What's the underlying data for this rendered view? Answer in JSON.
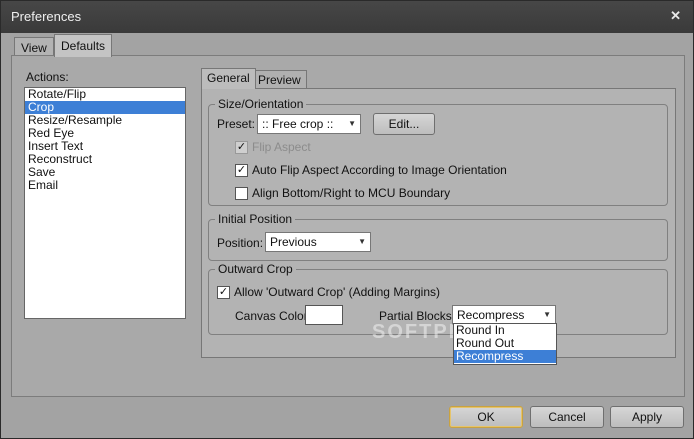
{
  "window": {
    "title": "Preferences",
    "close_glyph": "✕"
  },
  "outer_tabs": [
    {
      "label": "View"
    },
    {
      "label": "Defaults"
    }
  ],
  "actions": {
    "label": "Actions:",
    "items": [
      "Rotate/Flip",
      "Crop",
      "Resize/Resample",
      "Red Eye",
      "Insert Text",
      "Reconstruct",
      "Save",
      "Email"
    ],
    "selected": "Crop"
  },
  "inner_tabs": [
    {
      "label": "General"
    },
    {
      "label": "Preview"
    }
  ],
  "size_orientation": {
    "title": "Size/Orientation",
    "preset_label": "Preset:",
    "preset_value": ":: Free crop ::",
    "edit_button": "Edit...",
    "flip_aspect": {
      "label": "Flip Aspect",
      "checked": true,
      "enabled": false
    },
    "auto_flip": {
      "label": "Auto Flip Aspect According to Image Orientation",
      "checked": true
    },
    "align_mcu": {
      "label": "Align Bottom/Right to MCU Boundary",
      "checked": false
    }
  },
  "initial_position": {
    "title": "Initial Position",
    "position_label": "Position:",
    "position_value": "Previous"
  },
  "outward_crop": {
    "title": "Outward Crop",
    "allow": {
      "label": "Allow 'Outward Crop' (Adding Margins)",
      "checked": true
    },
    "canvas_color_label": "Canvas Color:",
    "canvas_color": "#ffffff",
    "partial_blocks_label": "Partial Blocks:",
    "partial_blocks_value": "Recompress",
    "partial_blocks_options": [
      "Round In",
      "Round Out",
      "Recompress"
    ]
  },
  "buttons": {
    "ok": "OK",
    "cancel": "Cancel",
    "apply": "Apply"
  },
  "watermark": "SOFTPEDIA",
  "colors": {
    "selection": "#3d7fd6",
    "window_bg": "#a3a3a3",
    "titlebar": "#3f3f3f"
  }
}
